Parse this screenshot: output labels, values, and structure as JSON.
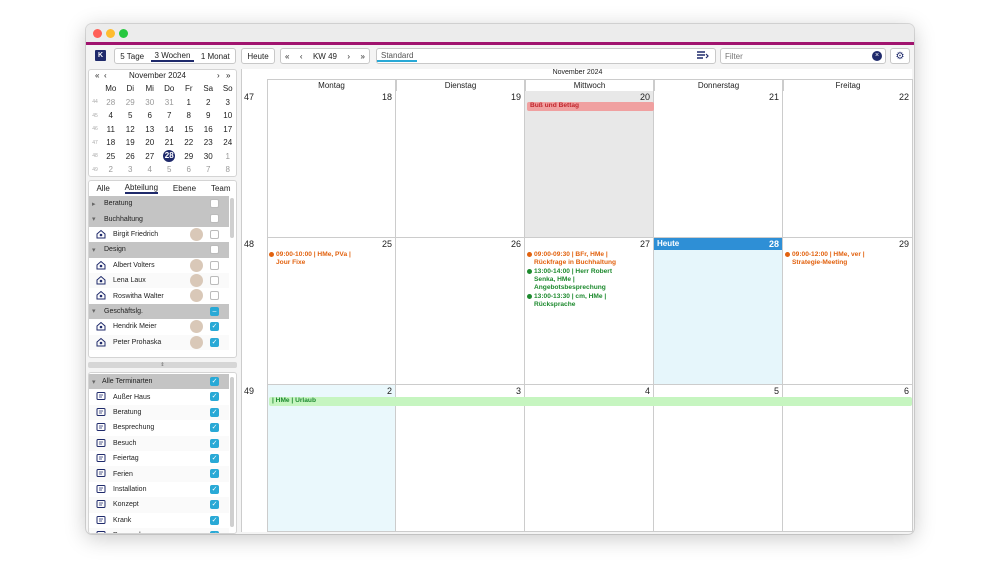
{
  "window": {
    "colors": {
      "accent": "#a0136e",
      "brand": "#1f2a6b",
      "today": "#2e8fd6",
      "holiday": "#f0a0a0",
      "vacation": "#c6f5c0",
      "check": "#29a9d6"
    }
  },
  "toolbar": {
    "logo_icon": "logo-icon",
    "views": [
      "5 Tage",
      "3 Wochen",
      "1 Monat"
    ],
    "today_label": "Heute",
    "nav_first": "«",
    "nav_prev": "‹",
    "week_label": "KW 49",
    "nav_next": "›",
    "nav_last": "»",
    "profile_value": "Standard",
    "filter_placeholder": "Filter",
    "clear_icon": "close-icon",
    "settings_icon": "gear-icon",
    "filter_icon": "filter-list-icon"
  },
  "mini_cal": {
    "nav_first": "«",
    "nav_prev": "‹",
    "month_title": "November 2024",
    "nav_next": "›",
    "nav_last": "»",
    "weekdays": [
      "Mo",
      "Di",
      "Mi",
      "Do",
      "Fr",
      "Sa",
      "So"
    ],
    "weeks": [
      {
        "wk": "44",
        "days": [
          "28",
          "29",
          "30",
          "31",
          "1",
          "2",
          "3"
        ]
      },
      {
        "wk": "45",
        "days": [
          "4",
          "5",
          "6",
          "7",
          "8",
          "9",
          "10"
        ]
      },
      {
        "wk": "46",
        "days": [
          "11",
          "12",
          "13",
          "14",
          "15",
          "16",
          "17"
        ]
      },
      {
        "wk": "47",
        "days": [
          "18",
          "19",
          "20",
          "21",
          "22",
          "23",
          "24"
        ]
      },
      {
        "wk": "48",
        "days": [
          "25",
          "26",
          "27",
          "28",
          "29",
          "30",
          "1"
        ]
      },
      {
        "wk": "49",
        "days": [
          "2",
          "3",
          "4",
          "5",
          "6",
          "7",
          "8"
        ]
      }
    ],
    "today": "28"
  },
  "people_panel": {
    "tabs": [
      "Alle",
      "Abteilung",
      "Ebene",
      "Team"
    ],
    "selected_tab": "Abteilung",
    "rows": [
      {
        "type": "group",
        "label": "Beratung",
        "expanded": false,
        "checked": false
      },
      {
        "type": "group",
        "label": "Buchhaltung",
        "expanded": true,
        "checked": false
      },
      {
        "type": "person",
        "label": "Birgit Friedrich",
        "checked": false
      },
      {
        "type": "group",
        "label": "Design",
        "expanded": true,
        "checked": false
      },
      {
        "type": "person",
        "label": "Albert Volters",
        "checked": false
      },
      {
        "type": "person",
        "label": "Lena Laux",
        "checked": false
      },
      {
        "type": "person",
        "label": "Roswitha Walter",
        "checked": false
      },
      {
        "type": "group",
        "label": "Geschäftslg.",
        "expanded": true,
        "checked": "partial"
      },
      {
        "type": "person",
        "label": "Hendrik Meier",
        "checked": true
      },
      {
        "type": "person",
        "label": "Peter Prohaska",
        "checked": true
      }
    ]
  },
  "types_panel": {
    "header": "Alle Terminarten",
    "items": [
      {
        "label": "Außer Haus",
        "icon": "house-walk-icon"
      },
      {
        "label": "Beratung",
        "icon": "handshake-icon"
      },
      {
        "label": "Besprechung",
        "icon": "chat-icon"
      },
      {
        "label": "Besuch",
        "icon": "route-icon"
      },
      {
        "label": "Feiertag",
        "icon": "calendar-star-icon"
      },
      {
        "label": "Ferien",
        "icon": "calendar-block-icon"
      },
      {
        "label": "Installation",
        "icon": "server-icon"
      },
      {
        "label": "Konzept",
        "icon": "list-icon"
      },
      {
        "label": "Krank",
        "icon": "bandage-icon"
      },
      {
        "label": "Personal",
        "icon": "person-icon"
      }
    ]
  },
  "calendar": {
    "month_title": "November 2024",
    "day_names": [
      "Montag",
      "Dienstag",
      "Mittwoch",
      "Donnerstag",
      "Freitag"
    ],
    "weeks": [
      {
        "kw": "47",
        "days": [
          "18",
          "19",
          "20",
          "21",
          "22"
        ]
      },
      {
        "kw": "48",
        "days": [
          "25",
          "26",
          "27",
          "28",
          "29"
        ]
      },
      {
        "kw": "49",
        "days": [
          "2",
          "3",
          "4",
          "5",
          "6"
        ]
      }
    ],
    "today_label": "Heute",
    "events": {
      "holiday": "Buß und Bettag",
      "mon25": [
        "09:00-10:00  | HMe, PVa |",
        "Jour Fixe"
      ],
      "wed27_1": [
        "09:00-09:30  | BFr, HMe |",
        "Rückfrage in Buchhaltung"
      ],
      "wed27_2": [
        "13:00-14:00  | Herr Robert",
        "Senka, HMe |",
        "Angebotsbesprechung"
      ],
      "wed27_3": [
        "13:00-13:30  | cm, HMe |",
        "Rücksprache"
      ],
      "fri29": [
        "09:00-12:00  | HMe, ver |",
        "Strategie-Meeting"
      ],
      "vacation": "| HMe | Urlaub"
    }
  }
}
